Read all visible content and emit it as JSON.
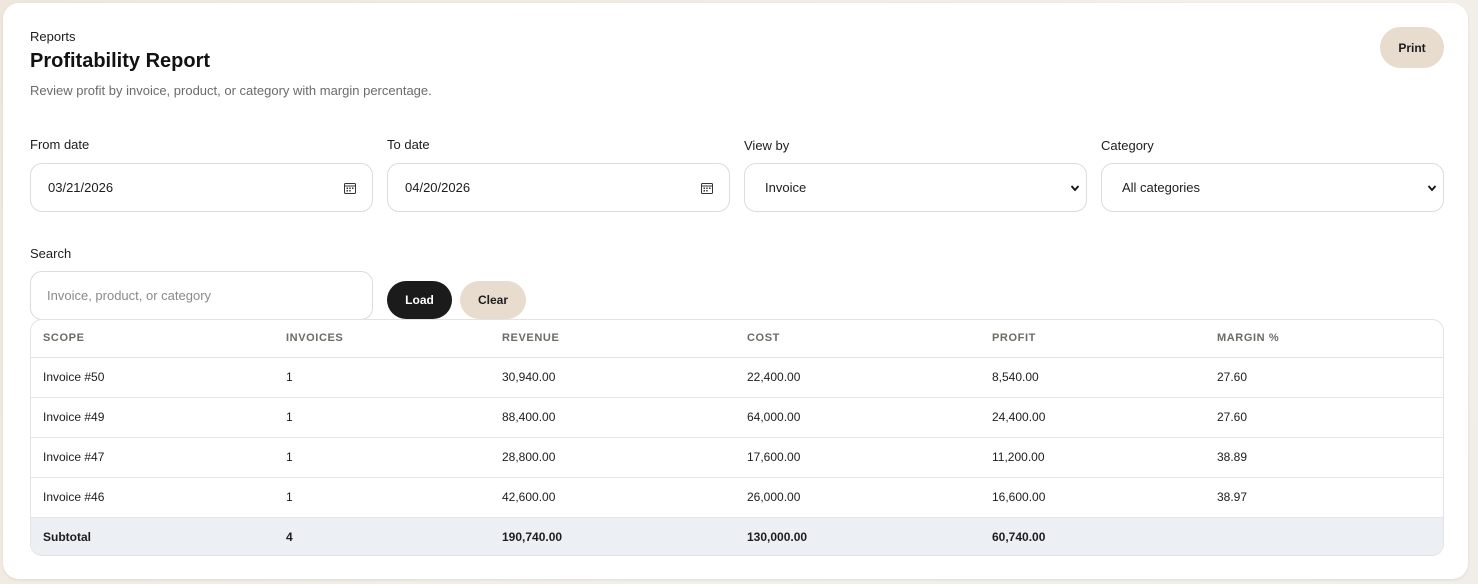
{
  "header": {
    "eyebrow": "Reports",
    "title": "Profitability Report",
    "subtitle": "Review profit by invoice, product, or category with margin percentage.",
    "print_label": "Print"
  },
  "filters": {
    "from_label": "From date",
    "from_value": "03/21/2026",
    "to_label": "To date",
    "to_value": "04/20/2026",
    "view_label": "View by",
    "view_value": "Invoice",
    "category_label": "Category",
    "category_value": "All categories",
    "search_label": "Search",
    "search_placeholder": "Invoice, product, or category",
    "load_label": "Load",
    "clear_label": "Clear"
  },
  "table": {
    "columns": [
      "SCOPE",
      "INVOICES",
      "REVENUE",
      "COST",
      "PROFIT",
      "MARGIN %"
    ],
    "rows": [
      [
        "Invoice #50",
        "1",
        "30,940.00",
        "22,400.00",
        "8,540.00",
        "27.60"
      ],
      [
        "Invoice #49",
        "1",
        "88,400.00",
        "64,000.00",
        "24,400.00",
        "27.60"
      ],
      [
        "Invoice #47",
        "1",
        "28,800.00",
        "17,600.00",
        "11,200.00",
        "38.89"
      ],
      [
        "Invoice #46",
        "1",
        "42,600.00",
        "26,000.00",
        "16,600.00",
        "38.97"
      ]
    ],
    "subtotal": [
      "Subtotal",
      "4",
      "190,740.00",
      "130,000.00",
      "60,740.00",
      ""
    ]
  },
  "icons": {
    "from_icon": "calendar-icon",
    "to_icon": "calendar-icon",
    "view_icon": "chevron-down-icon",
    "category_icon": "chevron-down-icon"
  },
  "colors": {
    "primary_button": "#1b1b1b",
    "secondary_button": "#e7dccd",
    "subtotal_row": "#eceff3"
  }
}
